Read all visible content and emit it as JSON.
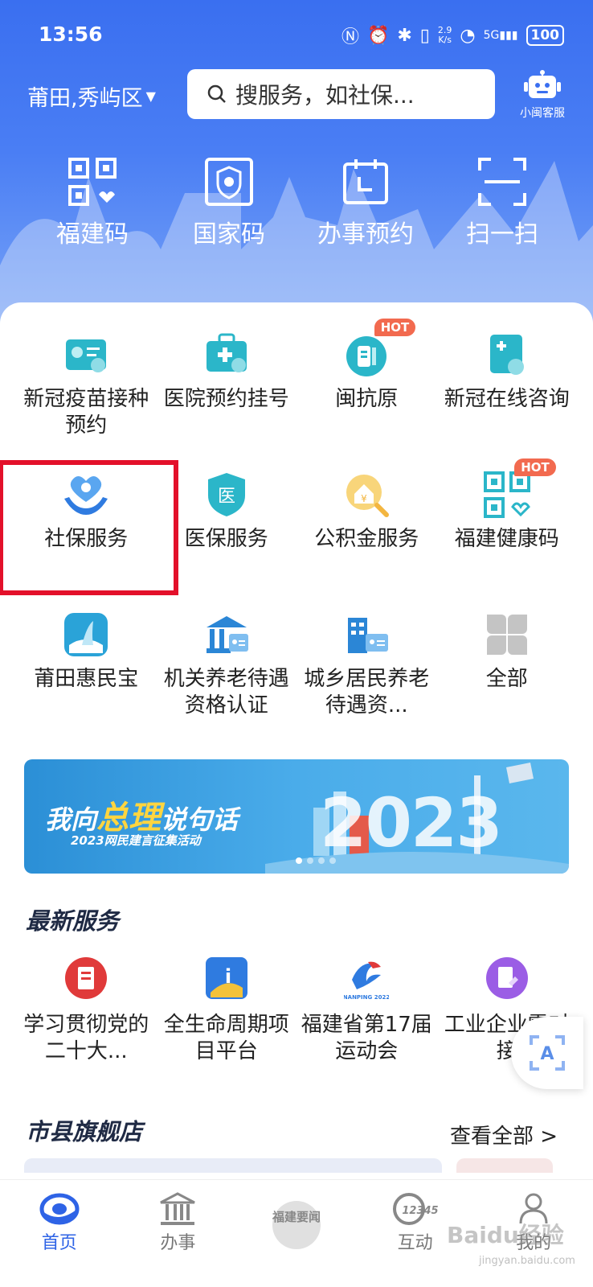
{
  "status_bar": {
    "time": "13:56",
    "net_speed_top": "2.9",
    "net_speed_bottom": "K/s",
    "battery": "100",
    "signal": "5G"
  },
  "header": {
    "location": "莆田,秀屿区",
    "search_placeholder": "搜服务，如社保...",
    "assistant_label": "小闽客服"
  },
  "quick": [
    {
      "label": "福建码",
      "icon": "health-qr-icon"
    },
    {
      "label": "国家码",
      "icon": "national-code-icon"
    },
    {
      "label": "办事预约",
      "icon": "calendar-icon"
    },
    {
      "label": "扫一扫",
      "icon": "scan-icon"
    }
  ],
  "services": [
    {
      "label": "新冠疫苗接种预约",
      "icon": "vaccine-icon",
      "color": "#2bb6c9"
    },
    {
      "label": "医院预约挂号",
      "icon": "hospital-kit-icon",
      "color": "#2bb6c9"
    },
    {
      "label": "闽抗原",
      "icon": "antigen-icon",
      "color": "#2bb6c9",
      "badge": "HOT"
    },
    {
      "label": "新冠在线咨询",
      "icon": "consult-icon",
      "color": "#2bb6c9"
    },
    {
      "label": "社保服务",
      "icon": "social-security-icon",
      "color": "#3b8fe6"
    },
    {
      "label": "医保服务",
      "icon": "medical-insurance-icon",
      "color": "#2bb6c9"
    },
    {
      "label": "公积金服务",
      "icon": "housing-fund-icon",
      "color": "#f3b640"
    },
    {
      "label": "福建健康码",
      "icon": "health-code-icon",
      "color": "#2bb6c9",
      "badge": "HOT"
    },
    {
      "label": "莆田惠民宝",
      "icon": "huiminbao-icon",
      "color": "#2aa3d8"
    },
    {
      "label": "机关养老待遇资格认证",
      "icon": "pension-icon",
      "color": "#2b86d6"
    },
    {
      "label": "城乡居民养老待遇资...",
      "icon": "resident-pension-icon",
      "color": "#2b86d6"
    },
    {
      "label": "全部",
      "icon": "all-icon",
      "color": "#bdbdbd"
    }
  ],
  "banner": {
    "title_pre": "我向",
    "title_em": "总理",
    "title_post": "说句话",
    "subtitle": "2023网民建言征集活动",
    "year": "2023"
  },
  "latest": {
    "title": "最新服务",
    "items": [
      {
        "label": "学习贯彻党的二十大...",
        "icon": "party-study-icon",
        "color": "#e03a3a"
      },
      {
        "label": "全生命周期项目平台",
        "icon": "project-platform-icon",
        "color": "#2f7be0"
      },
      {
        "label": "福建省第17届运动会",
        "icon": "sports-games-icon",
        "color": "#2f7be0",
        "sublabel": "NANPING 2022"
      },
      {
        "label": "工业企业需对接",
        "icon": "industry-icon",
        "color": "#9b5de5"
      }
    ]
  },
  "flagship": {
    "title": "市县旗舰店",
    "more": "查看全部 >"
  },
  "tabs": [
    {
      "label": "首页",
      "active": true
    },
    {
      "label": "办事"
    },
    {
      "label": "福建要闻"
    },
    {
      "label": "互动",
      "sublabel": "12345"
    },
    {
      "label": "我的"
    }
  ],
  "watermark": {
    "text": "Baidu经验",
    "url": "jingyan.baidu.com"
  }
}
